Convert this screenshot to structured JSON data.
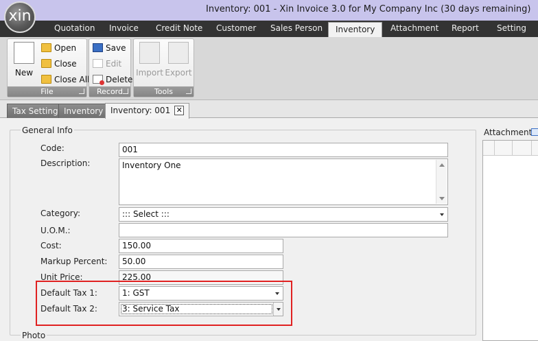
{
  "window": {
    "logo_text": "xin",
    "title": "Inventory: 001 - Xin Invoice 3.0 for My Company Inc (30 days remaining)"
  },
  "menu": [
    {
      "label": "Quotation"
    },
    {
      "label": "Invoice"
    },
    {
      "label": "Credit Note"
    },
    {
      "label": "Customer"
    },
    {
      "label": "Sales Person"
    },
    {
      "label": "Inventory",
      "active": true
    },
    {
      "label": "Attachment"
    },
    {
      "label": "Report"
    },
    {
      "label": "Setting"
    }
  ],
  "ribbon": {
    "file": {
      "title": "File",
      "new": "New",
      "open": "Open",
      "close": "Close",
      "close_all": "Close All"
    },
    "record": {
      "title": "Record",
      "save": "Save",
      "edit": "Edit",
      "delete": "Delete"
    },
    "tools": {
      "title": "Tools",
      "import": "Import",
      "export": "Export"
    }
  },
  "doc_tabs": [
    {
      "label": "Tax Setting"
    },
    {
      "label": "Inventory"
    },
    {
      "label": "Inventory: 001",
      "active": true,
      "close": "✕"
    }
  ],
  "form": {
    "section_title": "General Info",
    "code": {
      "label": "Code:",
      "value": "001"
    },
    "description": {
      "label": "Description:",
      "value": "Inventory One"
    },
    "category": {
      "label": "Category:",
      "value": "::: Select :::"
    },
    "uom": {
      "label": "U.O.M.:",
      "value": ""
    },
    "cost": {
      "label": "Cost:",
      "value": "150.00"
    },
    "markup": {
      "label": "Markup Percent:",
      "value": "50.00"
    },
    "unit_price": {
      "label": "Unit Price:",
      "value": "225.00"
    },
    "tax1": {
      "label": "Default Tax 1:",
      "value": "1: GST"
    },
    "tax2": {
      "label": "Default Tax 2:",
      "value": "3: Service Tax"
    },
    "photo_title": "Photo"
  },
  "attachment": {
    "label": "Attachment"
  },
  "colors": {
    "highlight": "#e02020",
    "menubar": "#333333",
    "titlebar": "#c8c4ec"
  }
}
